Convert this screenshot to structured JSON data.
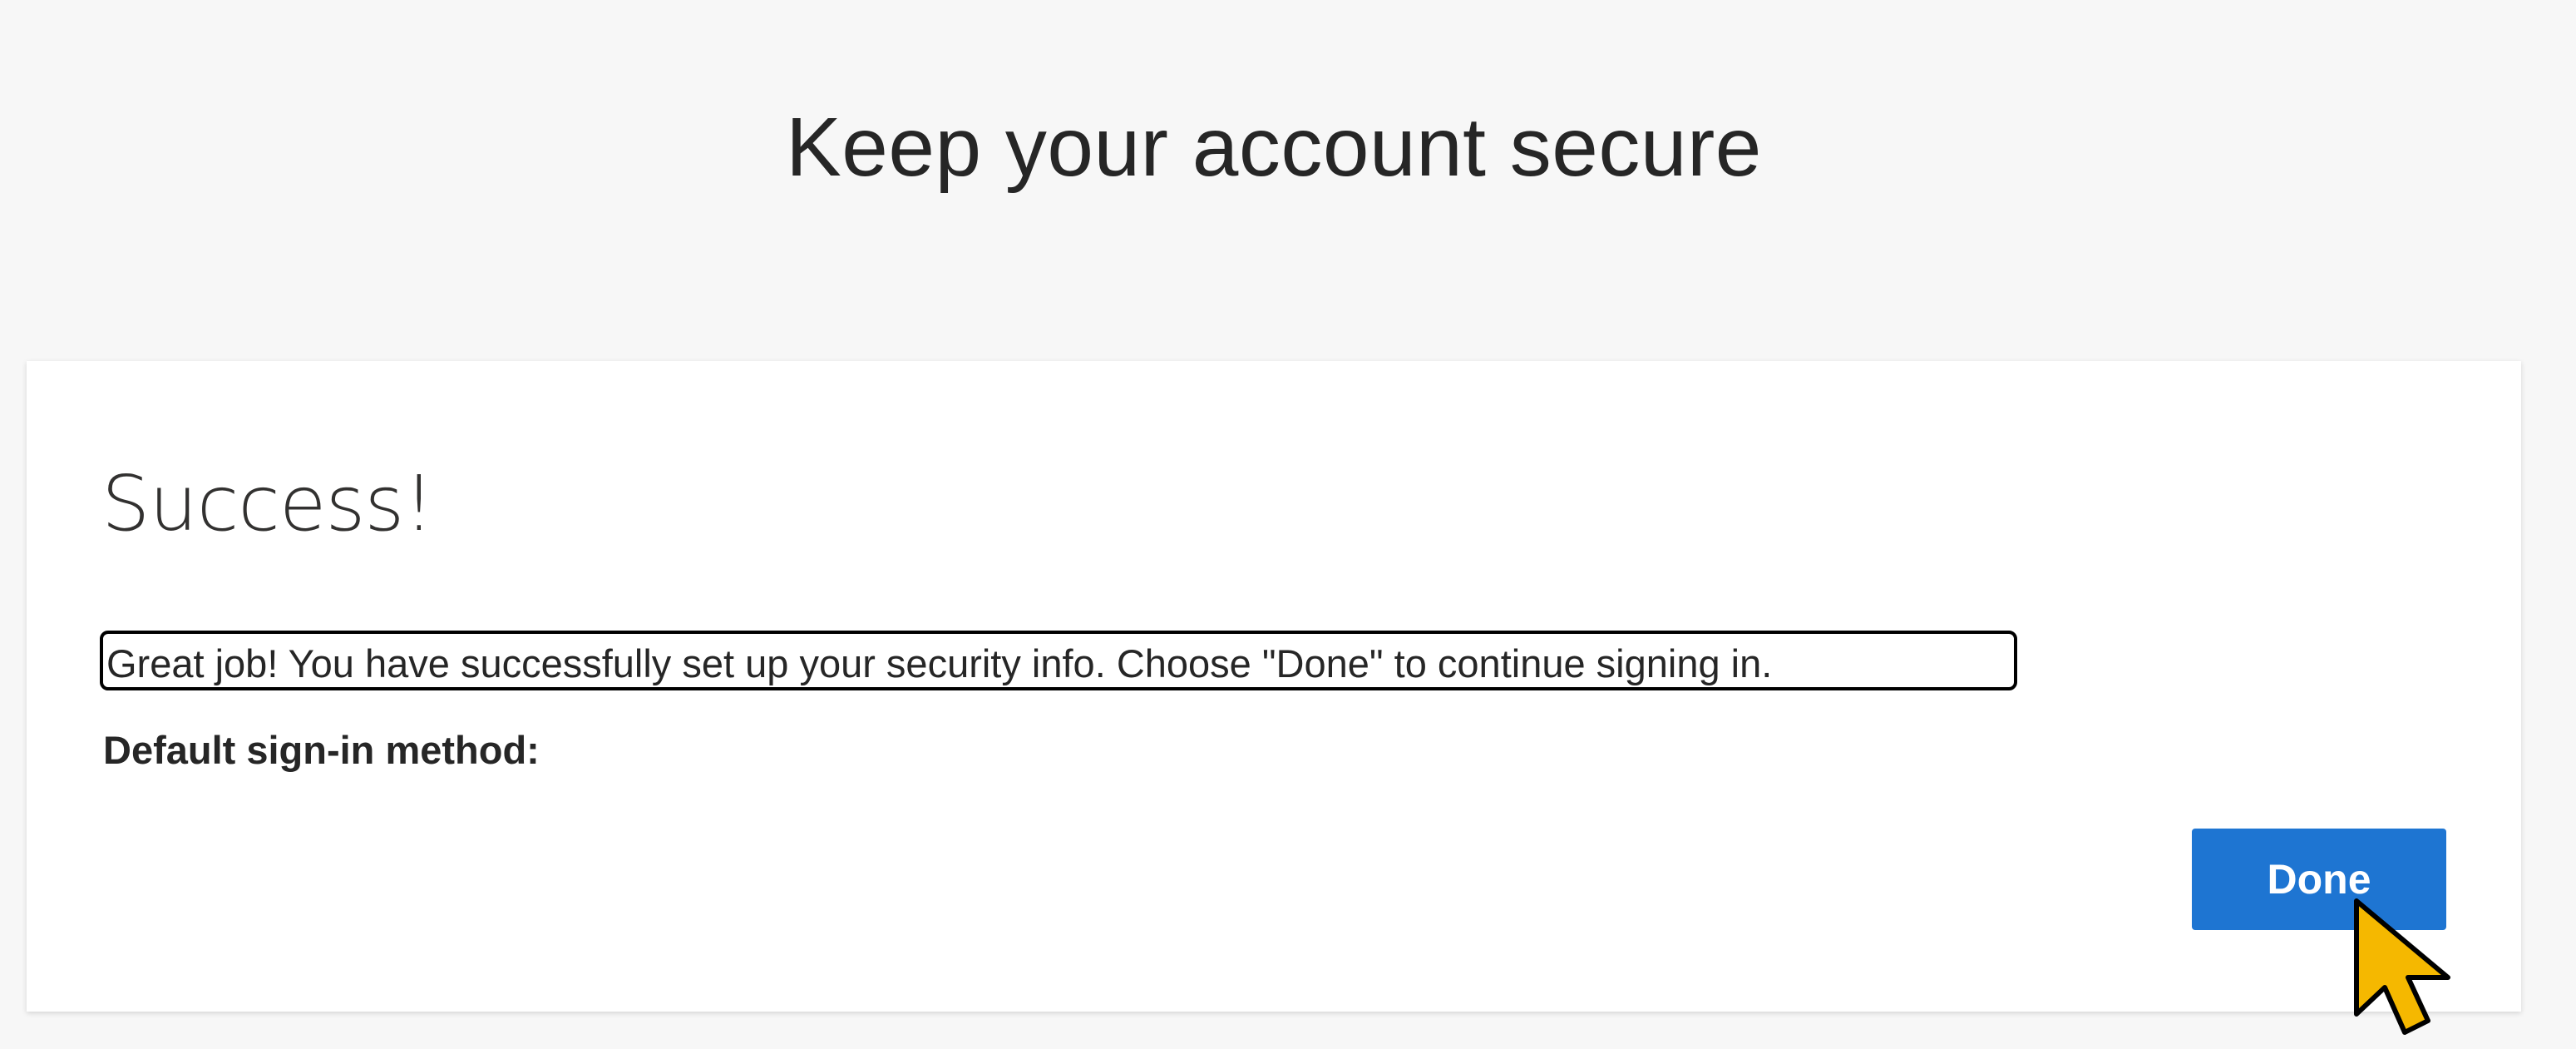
{
  "header": {
    "title": "Keep your account secure"
  },
  "card": {
    "heading": "Success!",
    "message": "Great job! You have successfully set up your security info. Choose \"Done\" to continue signing in.",
    "default_method_label": "Default sign-in method:",
    "done_label": "Done"
  },
  "colors": {
    "page_background": "#f7f7f7",
    "card_background": "#ffffff",
    "primary_button": "#1e75d2",
    "cursor_fill": "#f5b800"
  },
  "icons": {
    "cursor": "mouse-pointer-icon"
  }
}
